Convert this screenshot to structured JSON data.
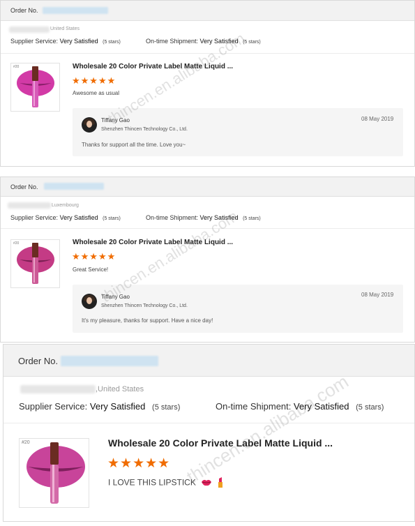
{
  "orders": [
    {
      "order_label": "Order No.",
      "country": "United States",
      "supplier_service_label": "Supplier Service:",
      "supplier_service_value": "Very Satisfied",
      "supplier_service_stars": "(5 stars)",
      "shipment_label": "On-time Shipment:",
      "shipment_value": "Very Satisfied",
      "shipment_stars": "(5 stars)",
      "thumb_number": "#20",
      "product_title": "Wholesale 20 Color Private Label Matte Liquid ...",
      "rating": "★★★★★",
      "comment": "Awesome as usual",
      "reply": {
        "name": "Tiffany Gao",
        "company": "Shenzhen Thincen Technology Co., Ltd.",
        "date": "08 May 2019",
        "text": "Thanks for support all the time. Love you~"
      }
    },
    {
      "order_label": "Order No.",
      "country": "Luxembourg",
      "supplier_service_label": "Supplier Service:",
      "supplier_service_value": "Very Satisfied",
      "supplier_service_stars": "(5 stars)",
      "shipment_label": "On-time Shipment:",
      "shipment_value": "Very Satisfied",
      "shipment_stars": "(5 stars)",
      "thumb_number": "#20",
      "product_title": "Wholesale 20 Color Private Label Matte Liquid ...",
      "rating": "★★★★★",
      "comment": "Great Service!",
      "reply": {
        "name": "Tiffany Gao",
        "company": "Shenzhen Thincen Technology Co., Ltd.",
        "date": "08 May 2019",
        "text": "It's my pleasure, thanks for support. Have a nice day!"
      }
    },
    {
      "order_label": "Order No.",
      "country": ",United States",
      "supplier_service_label": "Supplier Service:",
      "supplier_service_value": "Very Satisfied",
      "supplier_service_stars": "(5 stars)",
      "shipment_label": "On-time Shipment:",
      "shipment_value": "Very Satisfied",
      "shipment_stars": "(5 stars)",
      "thumb_number": "#20",
      "product_title": "Wholesale 20 Color Private Label Matte Liquid ...",
      "rating": "★★★★★",
      "comment": "I LOVE THIS LIPSTICK"
    }
  ],
  "watermark_text": "thincen.en.alibaba.com",
  "colors": {
    "star": "#f06c00",
    "lip_1": "#d23aa6",
    "lip_2": "#c43b85",
    "lip_3": "#c8449a",
    "order_bar": "#f2f2f2",
    "reply_bg": "#f5f5f5"
  }
}
